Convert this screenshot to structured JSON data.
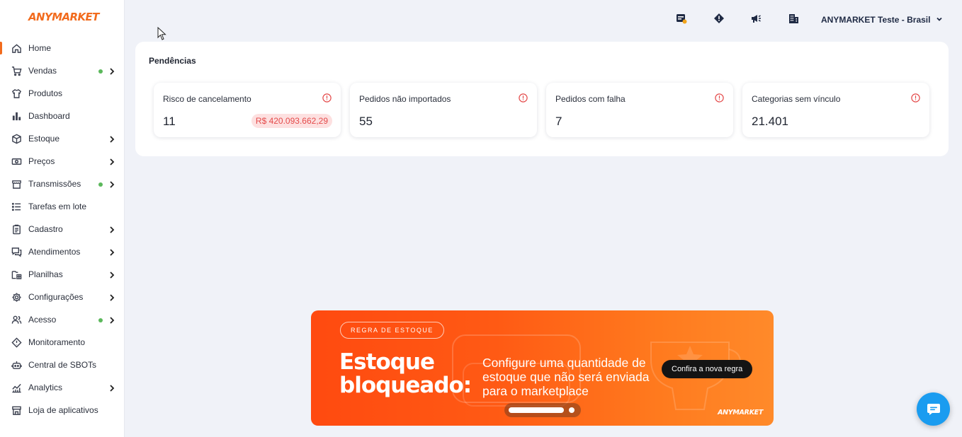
{
  "brand": {
    "logo_text": "ANYMARKET",
    "accent": "#f26b1d"
  },
  "sidebar": {
    "items": [
      {
        "label": "Home",
        "icon": "home-icon",
        "dot": false,
        "chevron": false,
        "active": true
      },
      {
        "label": "Vendas",
        "icon": "cart-icon",
        "dot": true,
        "chevron": true,
        "active": false
      },
      {
        "label": "Produtos",
        "icon": "shirt-icon",
        "dot": false,
        "chevron": false,
        "active": false
      },
      {
        "label": "Dashboard",
        "icon": "bar-chart-icon",
        "dot": false,
        "chevron": false,
        "active": false
      },
      {
        "label": "Estoque",
        "icon": "box-icon",
        "dot": false,
        "chevron": true,
        "active": false
      },
      {
        "label": "Preços",
        "icon": "money-icon",
        "dot": false,
        "chevron": true,
        "active": false
      },
      {
        "label": "Transmissões",
        "icon": "store-icon",
        "dot": true,
        "chevron": true,
        "active": false
      },
      {
        "label": "Tarefas em lote",
        "icon": "list-icon",
        "dot": false,
        "chevron": false,
        "active": false
      },
      {
        "label": "Cadastro",
        "icon": "clipboard-icon",
        "dot": false,
        "chevron": true,
        "active": false
      },
      {
        "label": "Atendimentos",
        "icon": "chat-icon",
        "dot": false,
        "chevron": true,
        "active": false
      },
      {
        "label": "Planilhas",
        "icon": "spreadsheet-folder-icon",
        "dot": false,
        "chevron": true,
        "active": false
      },
      {
        "label": "Configurações",
        "icon": "gear-icon",
        "dot": false,
        "chevron": true,
        "active": false
      },
      {
        "label": "Acesso",
        "icon": "users-icon",
        "dot": true,
        "chevron": true,
        "active": false
      },
      {
        "label": "Monitoramento",
        "icon": "diamond-alert-icon",
        "dot": false,
        "chevron": false,
        "active": false
      },
      {
        "label": "Central de SBOTs",
        "icon": "robot-icon",
        "dot": false,
        "chevron": false,
        "active": false
      },
      {
        "label": "Analytics",
        "icon": "analytics-icon",
        "dot": false,
        "chevron": true,
        "active": false
      },
      {
        "label": "Loja de aplicativos",
        "icon": "shop-icon",
        "dot": false,
        "chevron": false,
        "active": false
      }
    ]
  },
  "topbar": {
    "icons": [
      "billing-icon",
      "diamond-info-icon",
      "megaphone-icon",
      "building-icon"
    ],
    "account_name": "ANYMARKET Teste - Brasil"
  },
  "pendencias": {
    "title": "Pendências",
    "cards": [
      {
        "title": "Risco de cancelamento",
        "value": "11",
        "badge": "R$ 420.093.662,29"
      },
      {
        "title": "Pedidos não importados",
        "value": "55",
        "badge": ""
      },
      {
        "title": "Pedidos com falha",
        "value": "7",
        "badge": ""
      },
      {
        "title": "Categorias sem vínculo",
        "value": "21.401",
        "badge": ""
      }
    ]
  },
  "banner": {
    "tag": "REGRA DE ESTOQUE",
    "headline_line1": "Estoque",
    "headline_line2": "bloqueado:",
    "text": "Configure uma quantidade de estoque que não será enviada para o marketplace",
    "cta": "Confira a nova regra",
    "logo": "ANYMARKET"
  },
  "colors": {
    "alert_red": "#e44b4b",
    "status_green": "#5cb85c",
    "chat_blue": "#1a9cf0",
    "navy": "#1f2a44"
  }
}
